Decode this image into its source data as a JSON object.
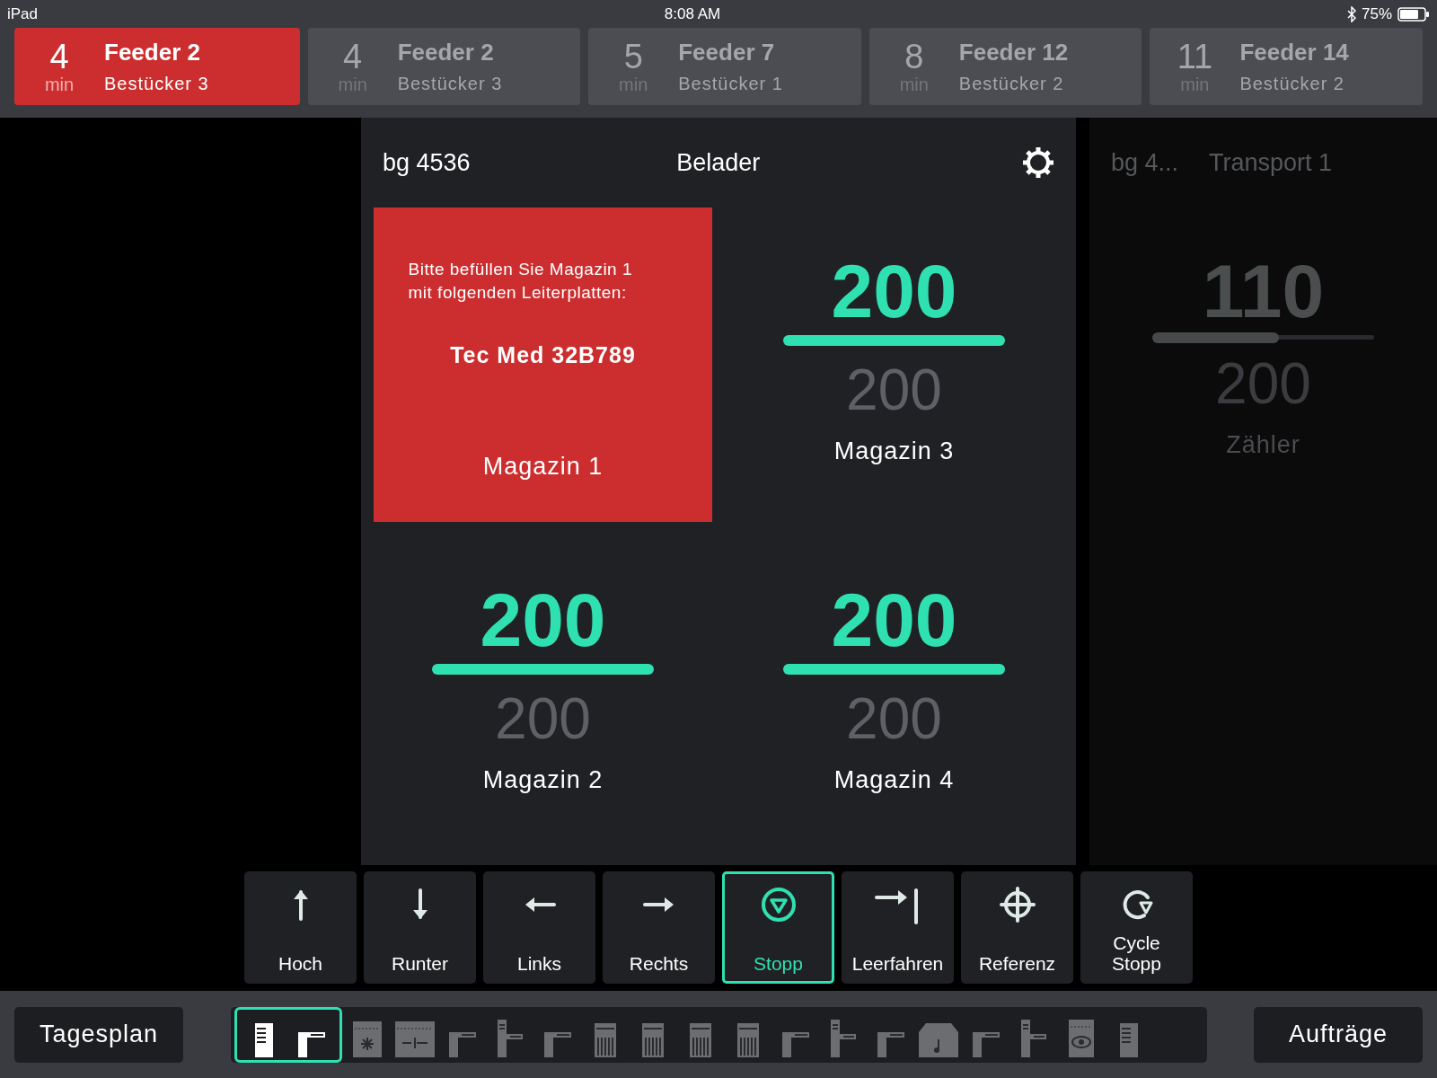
{
  "status_bar": {
    "device": "iPad",
    "time": "8:08 AM",
    "battery": "75%"
  },
  "tabs": [
    {
      "minutes": "4",
      "unit": "min",
      "feeder": "Feeder 2",
      "placer": "Bestücker 3",
      "selected": true
    },
    {
      "minutes": "4",
      "unit": "min",
      "feeder": "Feeder 2",
      "placer": "Bestücker 3",
      "selected": false
    },
    {
      "minutes": "5",
      "unit": "min",
      "feeder": "Feeder 7",
      "placer": "Bestücker 1",
      "selected": false
    },
    {
      "minutes": "8",
      "unit": "min",
      "feeder": "Feeder 12",
      "placer": "Bestücker 2",
      "selected": false
    },
    {
      "minutes": "11",
      "unit": "min",
      "feeder": "Feeder 14",
      "placer": "Bestücker 2",
      "selected": false
    }
  ],
  "panels": [
    {
      "board": "bg 4536",
      "title": "Belader",
      "active": true,
      "settings": true,
      "magazines": [
        {
          "kind": "alert",
          "message": "Bitte befüllen Sie Magazin 1\nmit folgenden Leiterplatten:",
          "part": "Tec Med 32B789",
          "label": "Magazin 1"
        },
        {
          "kind": "counter",
          "value": "200",
          "level": 1,
          "capacity": "200",
          "label": "Magazin 3"
        },
        {
          "kind": "counter",
          "value": "200",
          "level": 1,
          "capacity": "200",
          "label": "Magazin 2"
        },
        {
          "kind": "counter",
          "value": "200",
          "level": 1,
          "capacity": "200",
          "label": "Magazin 4"
        }
      ]
    },
    {
      "board": "bg 4...",
      "title": "Transport 1",
      "active": false,
      "settings": false,
      "magazines": [
        {
          "kind": "counter",
          "value": "110",
          "level": 0.57,
          "capacity": "200",
          "label": "Zähler"
        }
      ]
    }
  ],
  "controls": [
    {
      "label": "Hoch",
      "kind": "up",
      "selected": false
    },
    {
      "label": "Runter",
      "kind": "down",
      "selected": false
    },
    {
      "label": "Links",
      "kind": "left",
      "selected": false
    },
    {
      "label": "Rechts",
      "kind": "right",
      "selected": false
    },
    {
      "label": "Stopp",
      "kind": "stop",
      "selected": true
    },
    {
      "label": "Leerfahren",
      "kind": "empty",
      "selected": false
    },
    {
      "label": "Referenz",
      "kind": "reference",
      "selected": false
    },
    {
      "label": "Cycle\nStopp",
      "kind": "cycle",
      "selected": false
    }
  ],
  "bottom_bar": {
    "left_button": "Tagesplan",
    "right_button": "Aufträge",
    "machines": [
      {
        "kind": "loader",
        "selected": true
      },
      {
        "kind": "transport",
        "selected": true
      },
      {
        "kind": "printer",
        "selected": false
      },
      {
        "kind": "inspector",
        "selected": false
      },
      {
        "kind": "transport",
        "selected": false
      },
      {
        "kind": "tower",
        "selected": false
      },
      {
        "kind": "transport",
        "selected": false
      },
      {
        "kind": "magazine",
        "selected": false
      },
      {
        "kind": "magazine",
        "selected": false
      },
      {
        "kind": "magazine",
        "selected": false
      },
      {
        "kind": "magazine",
        "selected": false
      },
      {
        "kind": "transport",
        "selected": false
      },
      {
        "kind": "tower",
        "selected": false
      },
      {
        "kind": "transport",
        "selected": false
      },
      {
        "kind": "oven",
        "selected": false
      },
      {
        "kind": "transport",
        "selected": false
      },
      {
        "kind": "tower",
        "selected": false
      },
      {
        "kind": "camera",
        "selected": false
      },
      {
        "kind": "loader",
        "selected": false
      }
    ]
  }
}
